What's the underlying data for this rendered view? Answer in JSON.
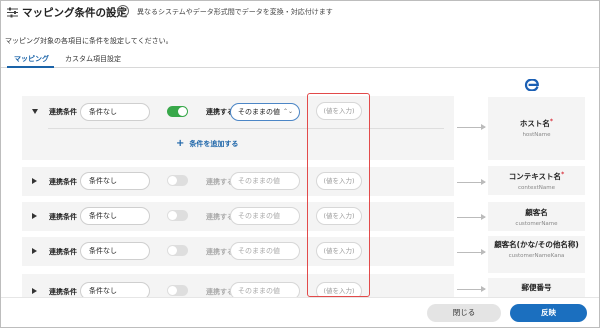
{
  "header": {
    "title": "マッピング条件の設定",
    "help_icon": "?",
    "description": "異なるシステムやデータ形式間でデータを変換・対応付けます"
  },
  "instruction": "マッピング対象の各項目に条件を設定してください。",
  "tabs": [
    {
      "label": "マッピング",
      "active": true
    },
    {
      "label": "カスタム項目設定",
      "active": false
    }
  ],
  "rows": [
    {
      "label": "連携条件",
      "condition": "条件なし",
      "link_label": "連携する値",
      "enabled": true,
      "select_value": "そのままの値",
      "value_placeholder": "(値を入力)",
      "expanded": true,
      "add_label": "条件を追加する"
    },
    {
      "label": "連携条件",
      "condition": "条件なし",
      "link_label": "連携する値",
      "enabled": false,
      "select_value": "そのままの値",
      "value_placeholder": "(値を入力)",
      "expanded": false
    },
    {
      "label": "連携条件",
      "condition": "条件なし",
      "link_label": "連携する値",
      "enabled": false,
      "select_value": "そのままの値",
      "value_placeholder": "(値を入力)",
      "expanded": false
    },
    {
      "label": "連携条件",
      "condition": "条件なし",
      "link_label": "連携する値",
      "enabled": false,
      "select_value": "そのままの値",
      "value_placeholder": "(値を入力)",
      "expanded": false
    },
    {
      "label": "連携条件",
      "condition": "条件なし",
      "link_label": "連携する値",
      "enabled": false,
      "select_value": "そのままの値",
      "value_placeholder": "(値を入力)",
      "expanded": false
    }
  ],
  "targets": [
    {
      "name": "ホスト名",
      "required": true,
      "key": "hostName"
    },
    {
      "name": "コンテキスト名",
      "required": true,
      "key": "contextName"
    },
    {
      "name": "顧客名",
      "required": false,
      "key": "customerName"
    },
    {
      "name": "顧客名(かな/その他名称)",
      "required": false,
      "key": "customerNameKana"
    },
    {
      "name": "郵便番号",
      "required": false,
      "key": ""
    }
  ],
  "required_mark": "*",
  "footer": {
    "close_label": "閉じる",
    "apply_label": "反映"
  },
  "colors": {
    "accent": "#1b6fbf",
    "toggle_on": "#38a84a",
    "highlight": "#e24a4a",
    "required": "#d9343f"
  }
}
